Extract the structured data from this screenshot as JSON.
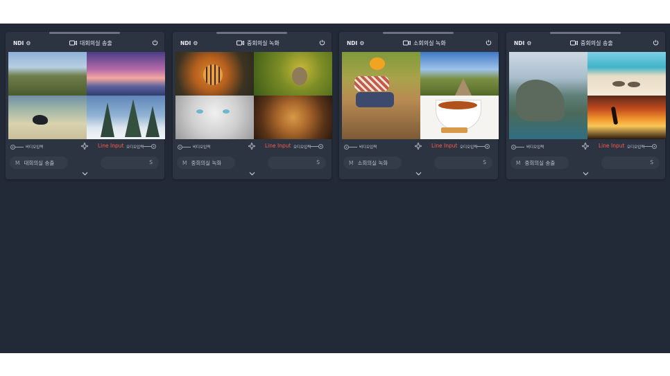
{
  "cards": [
    {
      "ndi": "NDI",
      "title": "대회의실 송출",
      "video_out": "비디오입력",
      "line_input": "Line Input",
      "audio_out": "오디오입력",
      "mute_label": "M",
      "room": "대회의실 송출",
      "solo_label": "S",
      "thumbs": [
        "landscape-grass-hill",
        "sunset-sea",
        "crow-on-beach",
        "snowy-pine-trees"
      ]
    },
    {
      "ndi": "NDI",
      "title": "중회의실 녹화",
      "video_out": "비디오입력",
      "line_input": "Line Input",
      "audio_out": "오디오입력",
      "mute_label": "M",
      "room": "중회의실 녹화",
      "solo_label": "S",
      "thumbs": [
        "tiger",
        "rabbit",
        "white-cat",
        "lion"
      ]
    },
    {
      "ndi": "NDI",
      "title": "소회의실 녹화",
      "video_out": "비디오입력",
      "line_input": "Line Input",
      "audio_out": "오디오입력",
      "mute_label": "M",
      "room": "소회의실 녹화",
      "solo_label": "S",
      "thumbs": [
        "person-planting",
        "field-road-sky",
        "tea-cup",
        "tea-cup"
      ]
    },
    {
      "ndi": "NDI",
      "title": "중회의실 송출",
      "video_out": "비디오입력",
      "line_input": "Line Input",
      "audio_out": "오디오입력",
      "mute_label": "M",
      "room": "중회의실 송출",
      "solo_label": "S",
      "thumbs": [
        "beach-sandals",
        "coastal-cliffs",
        "sunset-jump",
        "coastal-cliffs"
      ]
    }
  ],
  "colors": {
    "background": "#232a37",
    "card": "#2c3442",
    "accent_red": "#ff5a4f"
  }
}
